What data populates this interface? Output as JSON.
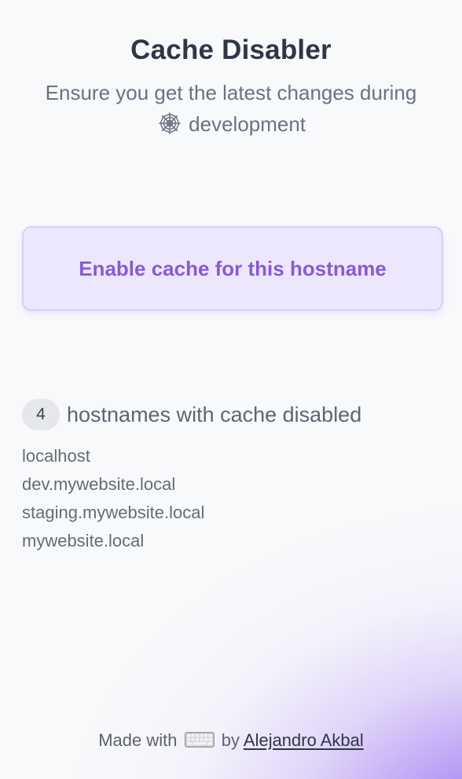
{
  "header": {
    "title": "Cache Disabler",
    "subtitle_before": "Ensure you get the latest changes during",
    "subtitle_icon": "spider-web-icon",
    "subtitle_after": "development"
  },
  "action": {
    "enable_label": "Enable cache for this hostname"
  },
  "hostnames": {
    "count": "4",
    "label": "hostnames with cache disabled",
    "items": [
      "localhost",
      "dev.mywebsite.local",
      "staging.mywebsite.local",
      "mywebsite.local"
    ]
  },
  "footer": {
    "made_with": "Made with",
    "icon": "keyboard-icon",
    "by": "by",
    "author": "Alejandro Akbal"
  },
  "colors": {
    "accent": "#8a5ad2",
    "button_bg": "#ede7fd",
    "button_border": "#d8cdfb",
    "glow": "#8b5cf6"
  }
}
